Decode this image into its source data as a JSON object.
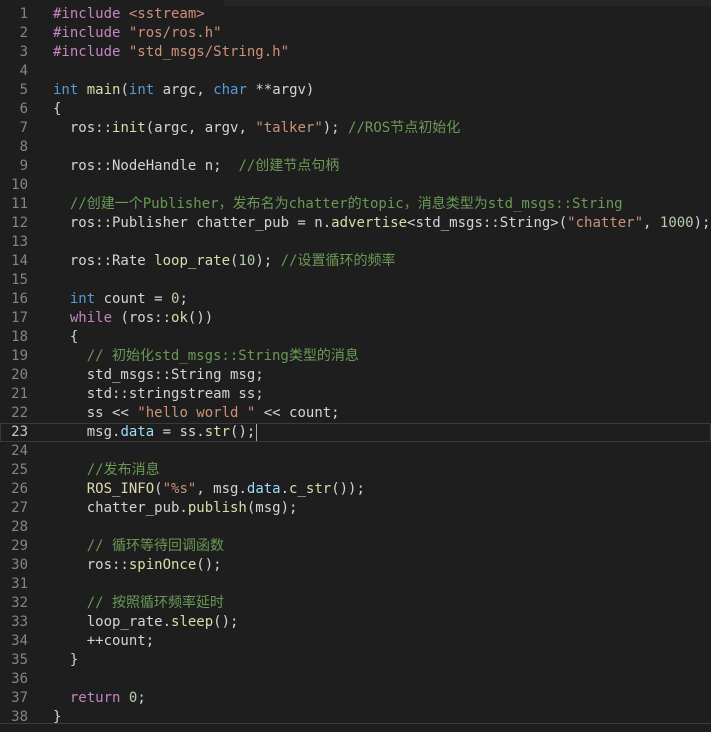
{
  "editor": {
    "language": "C++",
    "current_line": 23,
    "lines": [
      {
        "n": "1",
        "tokens": [
          [
            "pp",
            "#include "
          ],
          [
            "str",
            "<sstream>"
          ]
        ]
      },
      {
        "n": "2",
        "tokens": [
          [
            "pp",
            "#include "
          ],
          [
            "str",
            "\"ros/ros.h\""
          ]
        ]
      },
      {
        "n": "3",
        "tokens": [
          [
            "pp",
            "#include "
          ],
          [
            "str",
            "\"std_msgs/String.h\""
          ]
        ]
      },
      {
        "n": "4",
        "tokens": []
      },
      {
        "n": "5",
        "tokens": [
          [
            "kw",
            "int"
          ],
          [
            "plain",
            " "
          ],
          [
            "fn",
            "main"
          ],
          [
            "plain",
            "("
          ],
          [
            "kw",
            "int"
          ],
          [
            "plain",
            " argc, "
          ],
          [
            "kw",
            "char"
          ],
          [
            "plain",
            " **argv)"
          ]
        ]
      },
      {
        "n": "6",
        "tokens": [
          [
            "plain",
            "{"
          ]
        ]
      },
      {
        "n": "7",
        "tokens": [
          [
            "plain",
            "  ros::"
          ],
          [
            "fn",
            "init"
          ],
          [
            "plain",
            "(argc, argv, "
          ],
          [
            "str",
            "\"talker\""
          ],
          [
            "plain",
            "); "
          ],
          [
            "cm",
            "//ROS节点初始化"
          ]
        ]
      },
      {
        "n": "8",
        "tokens": []
      },
      {
        "n": "9",
        "tokens": [
          [
            "plain",
            "  ros::NodeHandle n;  "
          ],
          [
            "cm",
            "//创建节点句柄"
          ]
        ]
      },
      {
        "n": "10",
        "tokens": []
      },
      {
        "n": "11",
        "tokens": [
          [
            "cm",
            "  //创建一个Publisher，发布名为chatter的topic，消息类型为std_msgs::String"
          ]
        ]
      },
      {
        "n": "12",
        "tokens": [
          [
            "plain",
            "  ros::Publisher chatter_pub = n."
          ],
          [
            "fn",
            "advertise"
          ],
          [
            "plain",
            "<std_msgs::String>("
          ],
          [
            "str",
            "\"chatter\""
          ],
          [
            "plain",
            ", "
          ],
          [
            "num",
            "1000"
          ],
          [
            "plain",
            ");"
          ]
        ]
      },
      {
        "n": "13",
        "tokens": []
      },
      {
        "n": "14",
        "tokens": [
          [
            "plain",
            "  ros::Rate "
          ],
          [
            "fn",
            "loop_rate"
          ],
          [
            "plain",
            "("
          ],
          [
            "num",
            "10"
          ],
          [
            "plain",
            "); "
          ],
          [
            "cm",
            "//设置循环的频率"
          ]
        ]
      },
      {
        "n": "15",
        "tokens": []
      },
      {
        "n": "16",
        "tokens": [
          [
            "plain",
            "  "
          ],
          [
            "kw",
            "int"
          ],
          [
            "plain",
            " count = "
          ],
          [
            "num",
            "0"
          ],
          [
            "plain",
            ";"
          ]
        ]
      },
      {
        "n": "17",
        "tokens": [
          [
            "plain",
            "  "
          ],
          [
            "ctl",
            "while"
          ],
          [
            "plain",
            " (ros::"
          ],
          [
            "fn",
            "ok"
          ],
          [
            "plain",
            "())"
          ]
        ]
      },
      {
        "n": "18",
        "tokens": [
          [
            "plain",
            "  {"
          ]
        ]
      },
      {
        "n": "19",
        "tokens": [
          [
            "cm",
            "    // 初始化std_msgs::String类型的消息"
          ]
        ]
      },
      {
        "n": "20",
        "tokens": [
          [
            "plain",
            "    std_msgs::String msg;"
          ]
        ]
      },
      {
        "n": "21",
        "tokens": [
          [
            "plain",
            "    std::stringstream ss;"
          ]
        ]
      },
      {
        "n": "22",
        "tokens": [
          [
            "plain",
            "    ss << "
          ],
          [
            "str",
            "\"hello world \""
          ],
          [
            "plain",
            " << count;"
          ]
        ]
      },
      {
        "n": "23",
        "tokens": [
          [
            "plain",
            "    msg."
          ],
          [
            "var",
            "data"
          ],
          [
            "plain",
            " = ss."
          ],
          [
            "fn",
            "str"
          ],
          [
            "plain",
            "();"
          ]
        ]
      },
      {
        "n": "24",
        "tokens": []
      },
      {
        "n": "25",
        "tokens": [
          [
            "cm",
            "    //发布消息"
          ]
        ]
      },
      {
        "n": "26",
        "tokens": [
          [
            "plain",
            "    "
          ],
          [
            "fn",
            "ROS_INFO"
          ],
          [
            "plain",
            "("
          ],
          [
            "str",
            "\"%s\""
          ],
          [
            "plain",
            ", msg."
          ],
          [
            "var",
            "data"
          ],
          [
            "plain",
            "."
          ],
          [
            "fn",
            "c_str"
          ],
          [
            "plain",
            "());"
          ]
        ]
      },
      {
        "n": "27",
        "tokens": [
          [
            "plain",
            "    chatter_pub."
          ],
          [
            "fn",
            "publish"
          ],
          [
            "plain",
            "(msg);"
          ]
        ]
      },
      {
        "n": "28",
        "tokens": []
      },
      {
        "n": "29",
        "tokens": [
          [
            "cm",
            "    // 循环等待回调函数"
          ]
        ]
      },
      {
        "n": "30",
        "tokens": [
          [
            "plain",
            "    ros::"
          ],
          [
            "fn",
            "spinOnce"
          ],
          [
            "plain",
            "();"
          ]
        ]
      },
      {
        "n": "31",
        "tokens": []
      },
      {
        "n": "32",
        "tokens": [
          [
            "cm",
            "    // 按照循环频率延时"
          ]
        ]
      },
      {
        "n": "33",
        "tokens": [
          [
            "plain",
            "    loop_rate."
          ],
          [
            "fn",
            "sleep"
          ],
          [
            "plain",
            "();"
          ]
        ]
      },
      {
        "n": "34",
        "tokens": [
          [
            "plain",
            "    ++count;"
          ]
        ]
      },
      {
        "n": "35",
        "tokens": [
          [
            "plain",
            "  }"
          ]
        ]
      },
      {
        "n": "36",
        "tokens": []
      },
      {
        "n": "37",
        "tokens": [
          [
            "plain",
            "  "
          ],
          [
            "ctl",
            "return"
          ],
          [
            "plain",
            " "
          ],
          [
            "num",
            "0"
          ],
          [
            "plain",
            ";"
          ]
        ]
      },
      {
        "n": "38",
        "tokens": [
          [
            "plain",
            "}"
          ]
        ]
      }
    ]
  },
  "colors": {
    "background": "#1e1e1e",
    "line_number": "#858585",
    "preprocessor": "#c586c0",
    "string": "#ce9178",
    "keyword": "#569cd6",
    "function": "#dcdcaa",
    "member": "#9cdcfe",
    "number": "#b5cea8",
    "comment": "#6a9955",
    "text": "#d4d4d4"
  }
}
